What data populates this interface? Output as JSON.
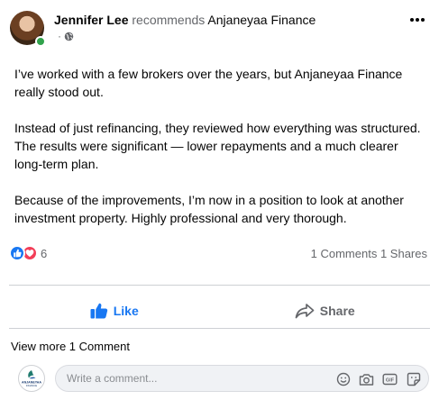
{
  "post": {
    "author": "Jennifer Lee",
    "action": "recommends",
    "page": "Anjaneyaa Finance",
    "meta_separator": "·",
    "paragraphs": [
      "I’ve worked with a few brokers over the years, but Anjaneyaa Finance really stood out.",
      "Instead of just refinancing, they reviewed how everything was structured. The results were significant — lower repayments and a much clearer long-term plan.",
      "Because of the improvements, I’m now in a position to look at another investment property. Highly professional and very thorough."
    ]
  },
  "stats": {
    "reaction_count": "6",
    "comments": "1 Comments",
    "shares": "1 Shares"
  },
  "actions": {
    "like_label": "Like",
    "share_label": "Share"
  },
  "comments": {
    "view_more": "View more 1 Comment",
    "placeholder": "Write a comment...",
    "page_logo_text": "ANJANEYAA FINANCE"
  },
  "icons": {
    "privacy": "globe-icon",
    "more": "more-options-icon",
    "reactions": [
      "like-reaction-icon",
      "love-reaction-icon"
    ],
    "like": "thumbs-up-icon",
    "share": "share-arrow-icon",
    "tools": [
      "emoji-icon",
      "camera-icon",
      "gif-icon",
      "sticker-icon"
    ]
  },
  "colors": {
    "brand_blue": "#1877f2",
    "love_red": "#f33e58",
    "online_green": "#31a24c",
    "muted_text": "#65676b"
  }
}
